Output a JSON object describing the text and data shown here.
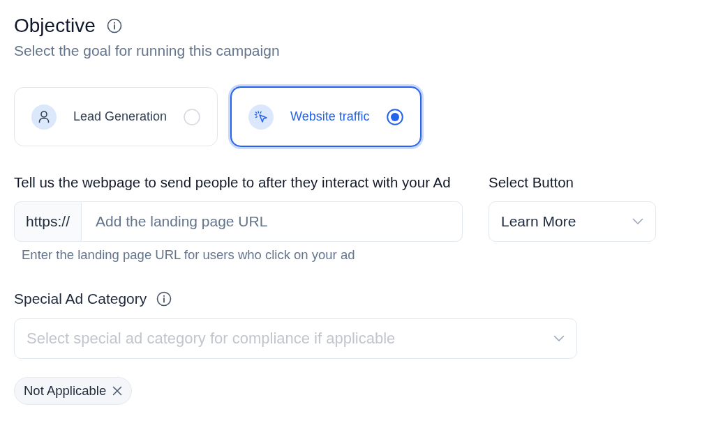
{
  "header": {
    "title": "Objective",
    "subtitle": "Select the goal for running this campaign"
  },
  "objectives": [
    {
      "kind": "person",
      "label": "Lead Generation",
      "selected": false
    },
    {
      "kind": "cursor",
      "label": "Website traffic",
      "selected": true
    }
  ],
  "landing_page": {
    "label": "Tell us the webpage to send people to after they interact with your Ad",
    "prefix": "https://",
    "placeholder": "Add the landing page URL",
    "hint": "Enter the landing page URL for users who click on your ad"
  },
  "select_button": {
    "label": "Select Button",
    "value": "Learn More"
  },
  "special_ad_category": {
    "label": "Special Ad Category",
    "placeholder": "Select special ad category for compliance if applicable",
    "tags": [
      {
        "label": "Not Applicable"
      }
    ]
  }
}
